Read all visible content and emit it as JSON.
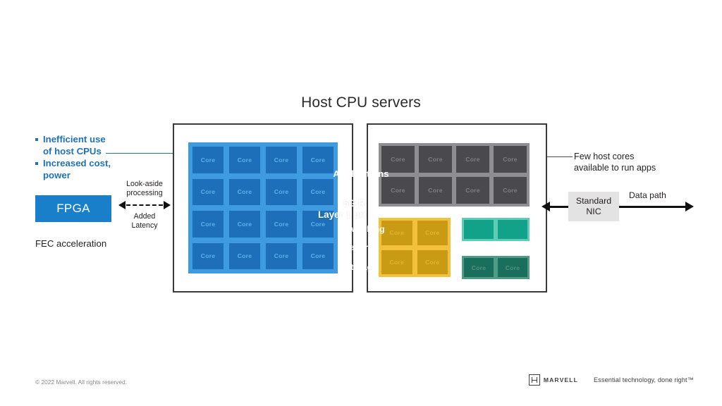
{
  "slide": {
    "title": "Host CPU servers"
  },
  "left_notes": {
    "bullets": [
      "Inefficient use of host CPUs",
      "Increased cost, power"
    ]
  },
  "fpga": {
    "label": "FPGA",
    "caption": "FEC acceleration",
    "color": "#1a7fcb"
  },
  "lookaside": {
    "top_label": "Look-aside processing",
    "bottom_label": "Added Latency",
    "arrow": "double-headed-dashed-arrow"
  },
  "left_panel": {
    "block_label": "5G RAN Layer 1 processing",
    "core_label": "Core",
    "core_count": 16,
    "rows": 4,
    "cols": 4,
    "bg_color": "#3e9be0",
    "core_color": "#1c6fb8"
  },
  "right_panel": {
    "blocks": [
      {
        "name": "applications",
        "label": "Applications",
        "core_label": "Core",
        "core_count": 8,
        "rows": 2,
        "cols": 4,
        "bg_color": "#8e8e93",
        "core_color": "#4a4a4e"
      },
      {
        "name": "security",
        "label": "Security",
        "core_label": "Core",
        "core_count": 4,
        "rows": 2,
        "cols": 2,
        "bg_color": "#f3c13c",
        "core_color": "#c99a13"
      },
      {
        "name": "networking",
        "label": "Networking",
        "core_label": "Core",
        "core_count": 2,
        "rows": 1,
        "cols": 2,
        "bg_color": "#5ecdb6",
        "core_color": "#12a189"
      },
      {
        "name": "storage",
        "label": "Storage",
        "core_label": "Core",
        "core_count": 2,
        "rows": 1,
        "cols": 2,
        "bg_color": "#4f9c86",
        "core_color": "#1a6e5c"
      }
    ]
  },
  "right_notes": {
    "few_cores": "Few host cores available to run apps",
    "nic_label": "Standard NIC",
    "data_path_label": "Data path"
  },
  "footer": {
    "copyright": "© 2022 Marvell. All rights reserved.",
    "wordmark": "MARVELL",
    "tagline": "Essential technology, done right™"
  }
}
